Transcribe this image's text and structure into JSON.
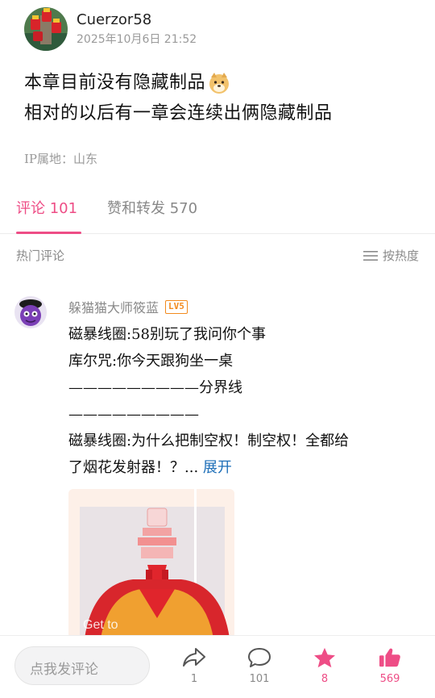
{
  "post": {
    "author": "Cuerzor58",
    "time": "2025年10月6日 21:52",
    "line1": "本章目前没有隐藏制品",
    "line2": "相对的以后有一章会连续出俩隐藏制品",
    "ip_location": "IP属地：山东"
  },
  "tabs": {
    "comments_label": "评论 101",
    "likes_label": "赞和转发 570"
  },
  "section": {
    "title": "热门评论",
    "sort_label": "按热度"
  },
  "comment": {
    "username": "躲猫猫大师筱蓝",
    "level": "LV5",
    "lines": [
      "磁暴线圈:58别玩了我问你个事",
      "库尔咒:你今天跟狗坐一桌",
      "—————————分界线",
      "—————————",
      "磁暴线圈:为什么把制空权！制空权！全都给",
      "了烟花发射器！？... "
    ],
    "expand_label": "展开",
    "image_watermark": "Get to"
  },
  "bottom_bar": {
    "input_placeholder": "点我发评论",
    "share_count": "1",
    "comment_count": "101",
    "favorite_count": "8",
    "like_count": "569"
  },
  "colors": {
    "accent": "#ee4d86",
    "link": "#1e6fb8",
    "level_badge": "#f28a1e"
  }
}
